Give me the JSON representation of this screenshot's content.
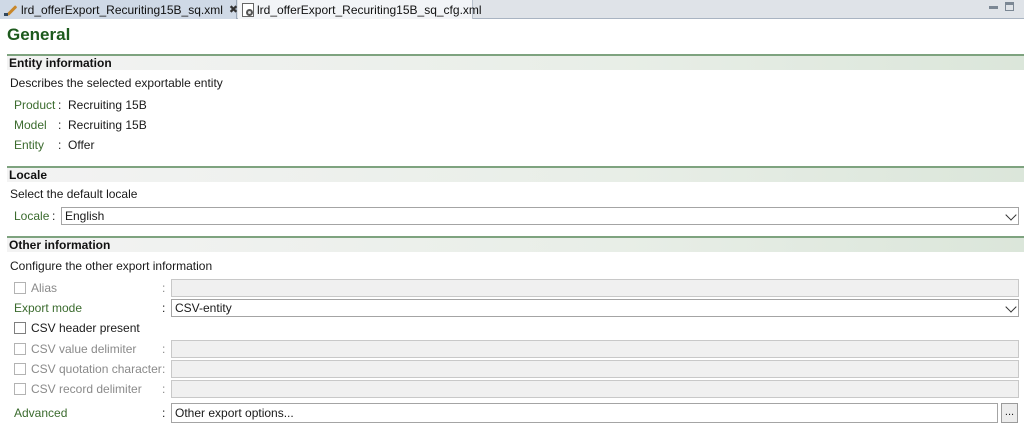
{
  "tabs": [
    {
      "label": "lrd_offerExport_Recuriting15B_sq.xml",
      "active": true,
      "icon": "pencil-icon",
      "close": "✖"
    },
    {
      "label": "lrd_offerExport_Recuriting15B_sq_cfg.xml",
      "active": false,
      "icon": "config-file-icon"
    }
  ],
  "page_title": "General",
  "entity_section": {
    "title": "Entity information",
    "description": "Describes the selected exportable entity",
    "rows": [
      {
        "label": "Product",
        "value": "Recruiting 15B"
      },
      {
        "label": "Model",
        "value": "Recruiting 15B"
      },
      {
        "label": "Entity",
        "value": "Offer"
      }
    ]
  },
  "locale_section": {
    "title": "Locale",
    "description": "Select the default locale",
    "label": "Locale",
    "value": "English"
  },
  "other_section": {
    "title": "Other information",
    "description": "Configure the other export information",
    "alias": {
      "label": "Alias",
      "checked": false,
      "enabled": false
    },
    "export_mode": {
      "label": "Export mode",
      "value": "CSV-entity"
    },
    "csv_header": {
      "label": "CSV header present",
      "checked": false
    },
    "csv_value_delim": {
      "label": "CSV value delimiter",
      "enabled": false
    },
    "csv_quote_char": {
      "label": "CSV quotation character",
      "enabled": false
    },
    "csv_record_delim": {
      "label": "CSV record delimiter",
      "enabled": false
    },
    "advanced": {
      "label": "Advanced",
      "value": "Other export options...",
      "button_label": "..."
    }
  },
  "colors": {
    "section_green": "#7ea37f",
    "title_green": "#1d5a1d",
    "label_green": "#3b6b2e"
  }
}
